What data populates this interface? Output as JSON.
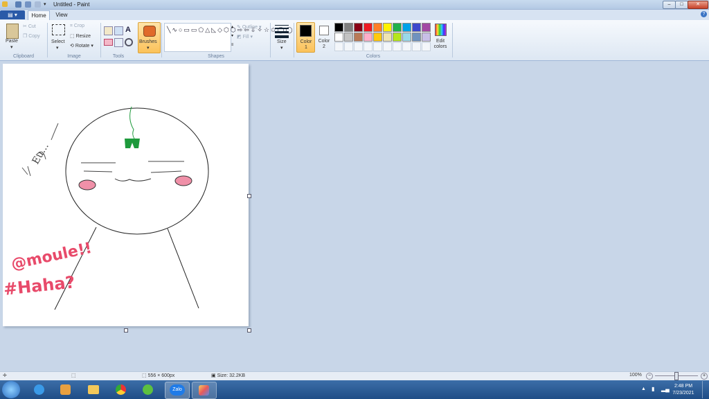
{
  "window": {
    "title": "Untitled - Paint",
    "min": "–",
    "max": "□",
    "close": "✕"
  },
  "tabs": {
    "file": "▤ ▾",
    "home": "Home",
    "view": "View"
  },
  "clipboard": {
    "paste": "Paste",
    "cut": "Cut",
    "copy": "Copy",
    "group": "Clipboard"
  },
  "image": {
    "select": "Select",
    "crop": "Crop",
    "resize": "Resize",
    "rotate": "Rotate",
    "group": "Image"
  },
  "tools": {
    "group": "Tools",
    "text_tool": "A"
  },
  "brushes": {
    "label": "Brushes"
  },
  "shapes": {
    "group": "Shapes",
    "outline": "Outline",
    "fill": "Fill"
  },
  "size": {
    "label": "Size"
  },
  "colors": {
    "color1_label": "Color 1",
    "color2_label": "Color 2",
    "edit_label": "Edit colors",
    "group": "Colors",
    "row1": [
      "#000000",
      "#7f7f7f",
      "#880015",
      "#ed1c24",
      "#ff7f27",
      "#fff200",
      "#22b14c",
      "#00a2e8",
      "#3f48cc",
      "#a349a4"
    ],
    "row2": [
      "#ffffff",
      "#c3c3c3",
      "#b97a57",
      "#ffaec9",
      "#ffc90e",
      "#efe4b0",
      "#b5e61d",
      "#99d9ea",
      "#7092be",
      "#c8bfe7"
    ],
    "color1": "#000000",
    "color2": "#ffffff"
  },
  "canvas_text": {
    "handle": "@moule!!",
    "tag": "#Haha?",
    "scribble": "Eu..."
  },
  "status": {
    "dimensions": "556 × 600px",
    "size": "Size: 32.2KB",
    "zoom": "100%"
  },
  "taskbar": {
    "zalo": "Zalo",
    "time": "2:48 PM",
    "date": "7/23/2021"
  }
}
